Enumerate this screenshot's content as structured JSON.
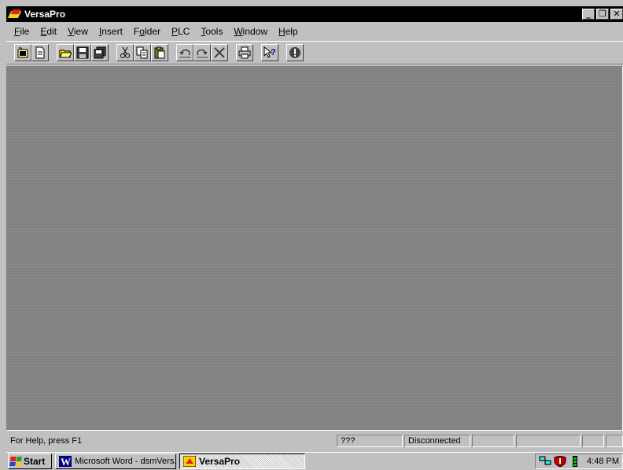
{
  "window": {
    "title": "VersaPro",
    "controls": [
      "_",
      "❐",
      "✕"
    ]
  },
  "menu": {
    "items": [
      {
        "label": "File",
        "mnemonic": "F"
      },
      {
        "label": "Edit",
        "mnemonic": "E"
      },
      {
        "label": "View",
        "mnemonic": "V"
      },
      {
        "label": "Insert",
        "mnemonic": "I"
      },
      {
        "label": "Folder",
        "mnemonic": "o"
      },
      {
        "label": "PLC",
        "mnemonic": "P"
      },
      {
        "label": "Tools",
        "mnemonic": "T"
      },
      {
        "label": "Window",
        "mnemonic": "W"
      },
      {
        "label": "Help",
        "mnemonic": "H"
      }
    ]
  },
  "toolbar": {
    "icons": [
      "new-folder-icon",
      "new-doc-icon",
      "open-icon",
      "save-icon",
      "save-all-icon",
      "cut-icon",
      "copy-icon",
      "paste-icon",
      "undo-icon",
      "redo-icon",
      "delete-icon",
      "print-icon",
      "context-help-icon",
      "stop-icon"
    ]
  },
  "status": {
    "help_text": "For Help, press F1",
    "indicator": "???",
    "connection": "Disconnected"
  },
  "taskbar": {
    "start_label": "Start",
    "tasks": [
      {
        "label": "Microsoft Word - dsmVers...",
        "active": false
      },
      {
        "label": "VersaPro",
        "active": true
      }
    ],
    "clock": "4:48 PM"
  },
  "colors": {
    "titlebar": "#000000",
    "chrome": "#c0c0c0",
    "workspace": "#808080"
  }
}
